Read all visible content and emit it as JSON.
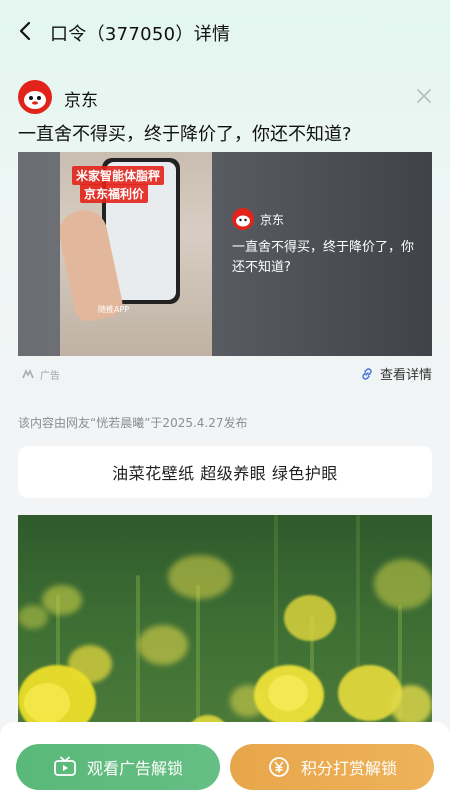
{
  "header": {
    "title": "口令（377050）详情"
  },
  "ad": {
    "brand_name": "京东",
    "headline": "一直舍不得买，终于降价了，你还不知道?",
    "video_caption_line1": "米家智能体脂秤",
    "video_caption_line2": "京东福利价",
    "video_watermark": "随推APP",
    "overlay_brand": "京东",
    "overlay_text": "一直舍不得买，终于降价了，你还不知道?",
    "ad_label": "广告",
    "detail_link": "查看详情"
  },
  "content": {
    "publish_info": "该内容由网友“恍若晨曦”于2025.4.27发布",
    "title": "油菜花壁纸 超级养眼 绿色护眼"
  },
  "actions": {
    "watch_ad_label": "观看广告解锁",
    "points_label": "积分打赏解锁"
  },
  "colors": {
    "jd_red": "#e2231a",
    "watch_green": "#5db97c",
    "points_orange": "#eaa84f"
  },
  "icons": [
    "back-arrow-icon",
    "close-icon",
    "ad-mark-icon",
    "link-icon",
    "tv-play-icon",
    "yen-coin-icon"
  ]
}
